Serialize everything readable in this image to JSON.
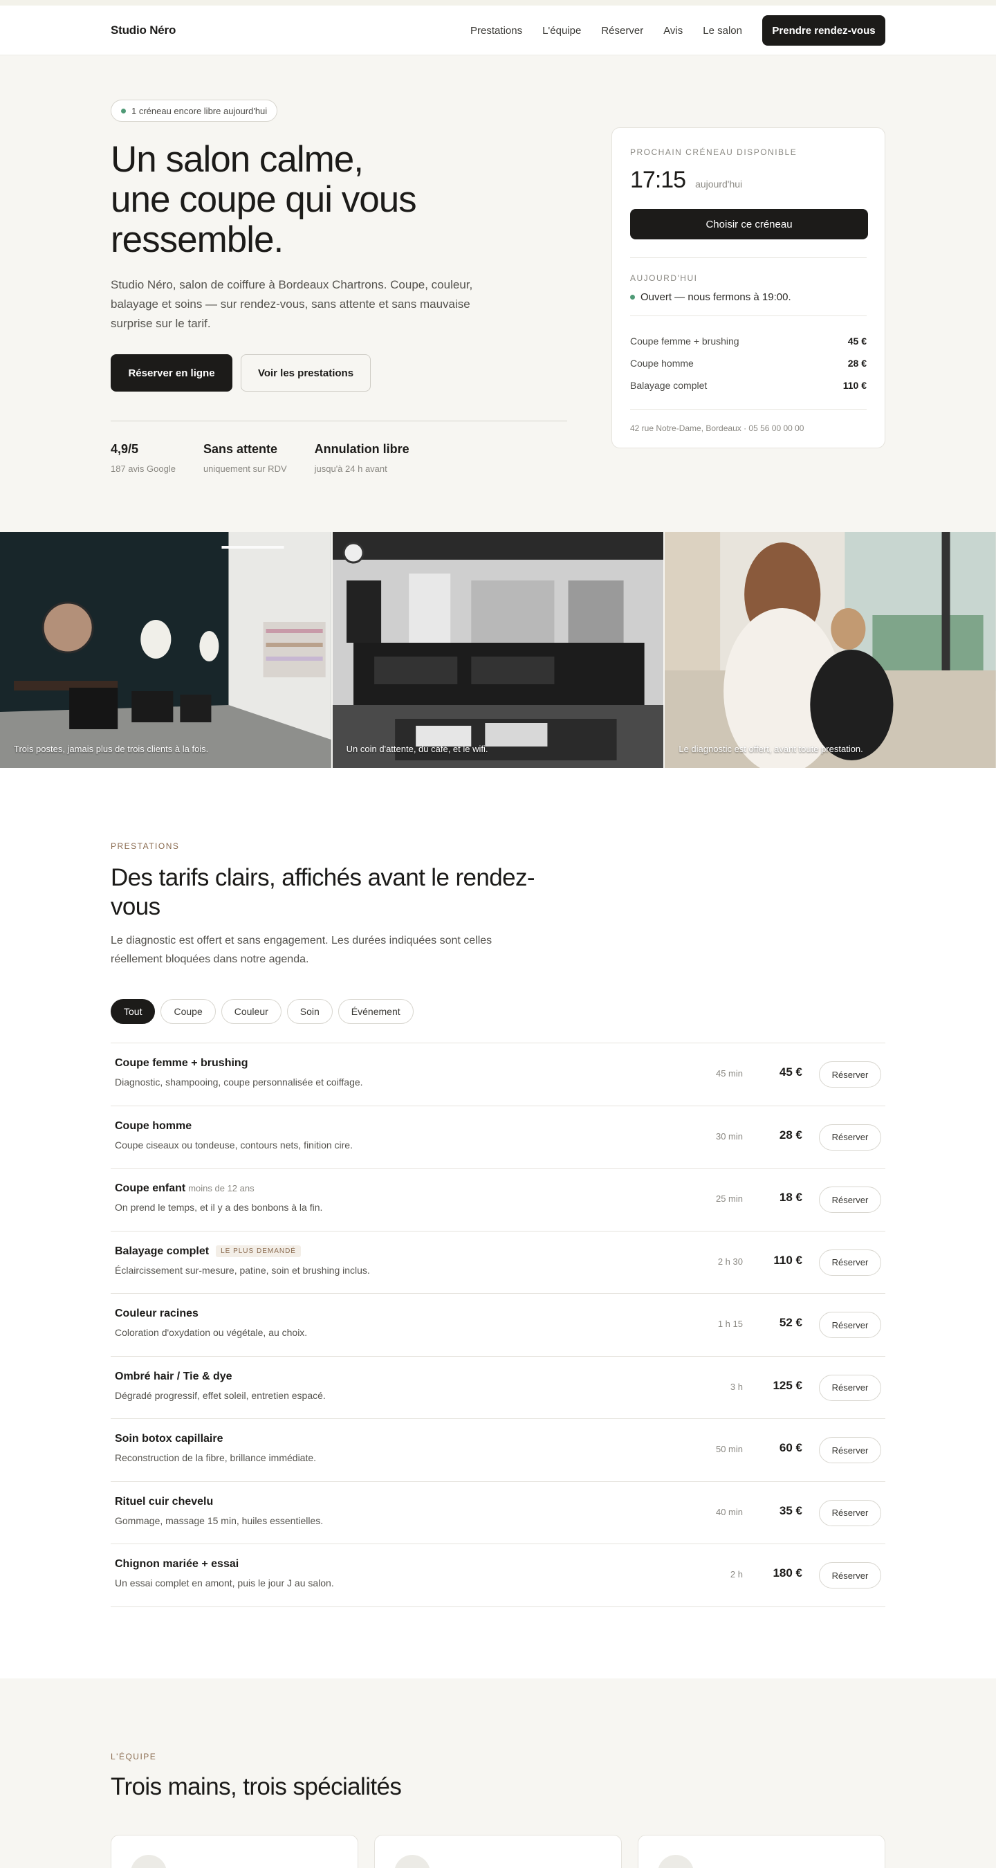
{
  "nav": {
    "brand": "Studio Néro",
    "links": [
      "Prestations",
      "L'équipe",
      "Réserver",
      "Avis",
      "Le salon"
    ],
    "cta": "Prendre rendez-vous"
  },
  "hero": {
    "availability": "1 créneau encore libre aujourd'hui",
    "title_lines": [
      "Un salon calme,",
      "une coupe qui vous",
      "ressemble."
    ],
    "lead": "Studio Néro, salon de coiffure à Bordeaux Chartrons. Coupe, couleur, balayage et soins — sur rendez-vous, sans attente et sans mauvaise surprise sur le tarif.",
    "primary_btn": "Réserver en ligne",
    "secondary_btn": "Voir les prestations",
    "stats": [
      {
        "value": "4,9/5",
        "label": "187 avis Google"
      },
      {
        "value": "Sans attente",
        "label": "uniquement sur RDV"
      },
      {
        "value": "Annulation libre",
        "label": "jusqu'à 24 h avant"
      }
    ]
  },
  "slot_card": {
    "eyebrow": "Prochain créneau disponible",
    "time": "17:15",
    "day": "aujourd'hui",
    "choose_btn": "Choisir ce créneau",
    "today_label": "Aujourd'hui",
    "open_status": "Ouvert — nous fermons à 19:00.",
    "prices": [
      {
        "name": "Coupe femme + brushing",
        "price": "45 €"
      },
      {
        "name": "Coupe homme",
        "price": "28 €"
      },
      {
        "name": "Balayage complet",
        "price": "110 €"
      }
    ],
    "address": "42 rue Notre-Dame, Bordeaux · 05 56 00 00 00"
  },
  "gallery": [
    {
      "caption": "Trois postes, jamais plus de trois clients à la fois."
    },
    {
      "caption": "Un coin d'attente, du café, et le wifi."
    },
    {
      "caption": "Le diagnostic est offert, avant toute prestation."
    }
  ],
  "services": {
    "eyebrow": "Prestations",
    "title": "Des tarifs clairs, affichés avant le rendez-vous",
    "lead": "Le diagnostic est offert et sans engagement. Les durées indiquées sont celles réellement bloquées dans notre agenda.",
    "filters": [
      "Tout",
      "Coupe",
      "Couleur",
      "Soin",
      "Événement"
    ],
    "book_label": "Réserver",
    "items": [
      {
        "name": "Coupe femme + brushing",
        "note": "",
        "badge": "",
        "desc": "Diagnostic, shampooing, coupe personnalisée et coiffage.",
        "duration": "45 min",
        "price": "45 €"
      },
      {
        "name": "Coupe homme",
        "note": "",
        "badge": "",
        "desc": "Coupe ciseaux ou tondeuse, contours nets, finition cire.",
        "duration": "30 min",
        "price": "28 €"
      },
      {
        "name": "Coupe enfant",
        "note": "moins de 12 ans",
        "badge": "",
        "desc": "On prend le temps, et il y a des bonbons à la fin.",
        "duration": "25 min",
        "price": "18 €"
      },
      {
        "name": "Balayage complet",
        "note": "",
        "badge": "Le plus demandé",
        "desc": "Éclaircissement sur-mesure, patine, soin et brushing inclus.",
        "duration": "2 h 30",
        "price": "110 €"
      },
      {
        "name": "Couleur racines",
        "note": "",
        "badge": "",
        "desc": "Coloration d'oxydation ou végétale, au choix.",
        "duration": "1 h 15",
        "price": "52 €"
      },
      {
        "name": "Ombré hair / Tie & dye",
        "note": "",
        "badge": "",
        "desc": "Dégradé progressif, effet soleil, entretien espacé.",
        "duration": "3 h",
        "price": "125 €"
      },
      {
        "name": "Soin botox capillaire",
        "note": "",
        "badge": "",
        "desc": "Reconstruction de la fibre, brillance immédiate.",
        "duration": "50 min",
        "price": "60 €"
      },
      {
        "name": "Rituel cuir chevelu",
        "note": "",
        "badge": "",
        "desc": "Gommage, massage 15 min, huiles essentielles.",
        "duration": "40 min",
        "price": "35 €"
      },
      {
        "name": "Chignon mariée + essai",
        "note": "",
        "badge": "",
        "desc": "Un essai complet en amont, puis le jour J au salon.",
        "duration": "2 h",
        "price": "180 €"
      }
    ]
  },
  "team": {
    "eyebrow": "L'équipe",
    "title": "Trois mains, trois spécialités"
  },
  "colors": {
    "ink": "#1c1b19",
    "accent": "#8a6b50",
    "open": "#4f9a76"
  }
}
